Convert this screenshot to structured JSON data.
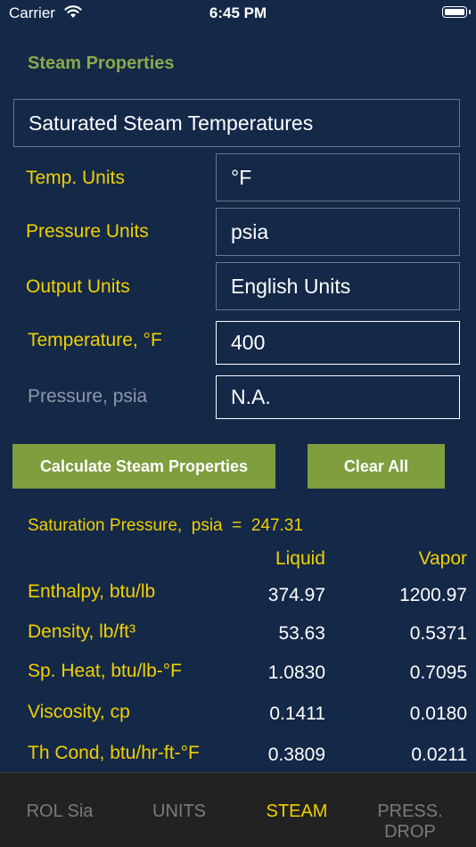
{
  "status": {
    "carrier": "Carrier",
    "time": "6:45 PM"
  },
  "title": "Steam Properties",
  "mode": "Saturated Steam Temperatures",
  "fields": {
    "temp_units_label": "Temp. Units",
    "temp_units_value": "°F",
    "pressure_units_label": "Pressure Units",
    "pressure_units_value": "psia",
    "output_units_label": "Output Units",
    "output_units_value": "English Units",
    "temperature_label": "Temperature,  °F",
    "temperature_value": "400",
    "pressure_label": "Pressure,  psia",
    "pressure_value": "N.A."
  },
  "buttons": {
    "calculate": "Calculate Steam Properties",
    "clear": "Clear All"
  },
  "results": {
    "saturation_label": "Saturation Pressure,  psia  =",
    "saturation_value": "247.31",
    "liquid_header": "Liquid",
    "vapor_header": "Vapor",
    "rows": [
      {
        "label": "Enthalpy, btu/lb",
        "liquid": "374.97",
        "vapor": "1200.97"
      },
      {
        "label": "Density, lb/ft³",
        "liquid": "53.63",
        "vapor": "0.5371"
      },
      {
        "label": "Sp. Heat, btu/lb-°F",
        "liquid": "1.0830",
        "vapor": "0.7095"
      },
      {
        "label": "Viscosity, cp",
        "liquid": "0.1411",
        "vapor": "0.0180"
      },
      {
        "label": "Th Cond, btu/hr-ft-°F",
        "liquid": "0.3809",
        "vapor": "0.0211"
      }
    ]
  },
  "tabs": [
    {
      "label": "ROL Sia"
    },
    {
      "label": "UNITS"
    },
    {
      "label": "STEAM",
      "active": true
    },
    {
      "label": "PRESS. DROP"
    }
  ],
  "colors": {
    "background": "#142848",
    "accent_yellow": "#f0d000",
    "button_green": "#7f9e3e",
    "title_green": "#8aa84a"
  },
  "icons": [
    "wifi-icon",
    "battery-icon"
  ]
}
